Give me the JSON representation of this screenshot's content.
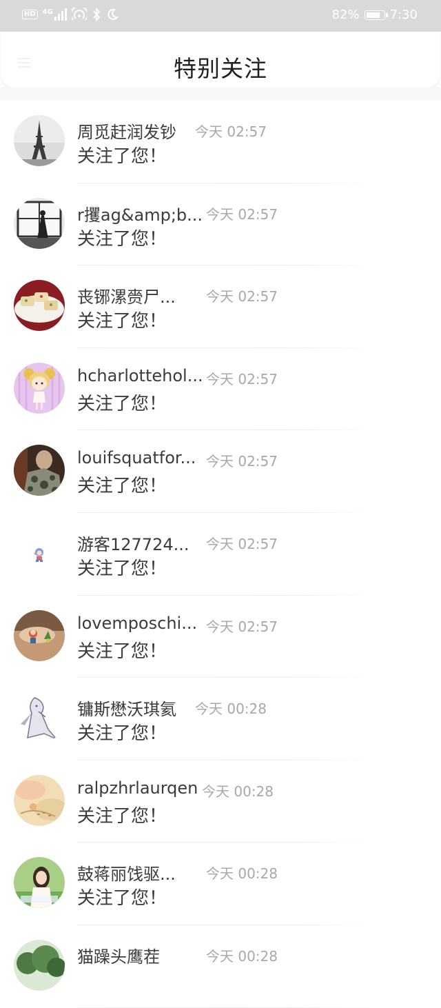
{
  "status_bar": {
    "hd": "HD",
    "network": "4G",
    "battery_pct": "82%",
    "battery_level": 0.82,
    "time": "7:30",
    "icons": [
      "hd-icon",
      "signal-icon",
      "hotspot-icon",
      "bluetooth-icon",
      "moon-icon"
    ]
  },
  "header": {
    "title": "特别关注",
    "menu_icon": "menu-icon"
  },
  "notifications": [
    {
      "name": "周觅赶润发钞",
      "time": "今天 02:57",
      "message": "关注了您！",
      "avatar": "eiffel-tower-avatar"
    },
    {
      "name": "r攫ag&amp;b...",
      "time": "今天 02:57",
      "message": "关注了您！",
      "avatar": "window-dancer-avatar"
    },
    {
      "name": "丧铘漯赍尸...",
      "time": "今天 02:57",
      "message": "关注了您！",
      "avatar": "food-plate-avatar"
    },
    {
      "name": "hcharlottehol...",
      "time": "今天 02:57",
      "message": "关注了您！",
      "avatar": "cartoon-girl-avatar"
    },
    {
      "name": "louifsquatfor...",
      "time": "今天 02:57",
      "message": "关注了您！",
      "avatar": "tattoo-person-avatar"
    },
    {
      "name": "游客127724...",
      "time": "今天 02:57",
      "message": "关注了您！",
      "avatar": "guest-default-avatar"
    },
    {
      "name": "lovemposchi...",
      "time": "今天 02:57",
      "message": "关注了您！",
      "avatar": "toy-figure-avatar"
    },
    {
      "name": "镛斯懋沃琪氦",
      "time": "今天 00:28",
      "message": "关注了您！",
      "avatar": "anime-character-avatar"
    },
    {
      "name": "ralpzhrlaurqen",
      "time": "今天 00:28",
      "message": "关注了您！",
      "avatar": "watercolor-avatar"
    },
    {
      "name": "鼓蒋丽饯驱...",
      "time": "今天 00:28",
      "message": "关注了您！",
      "avatar": "girl-garden-avatar"
    },
    {
      "name": "猫躁头鹰茬",
      "time": "今天 00:28",
      "message": "",
      "avatar": "tree-avatar"
    }
  ]
}
